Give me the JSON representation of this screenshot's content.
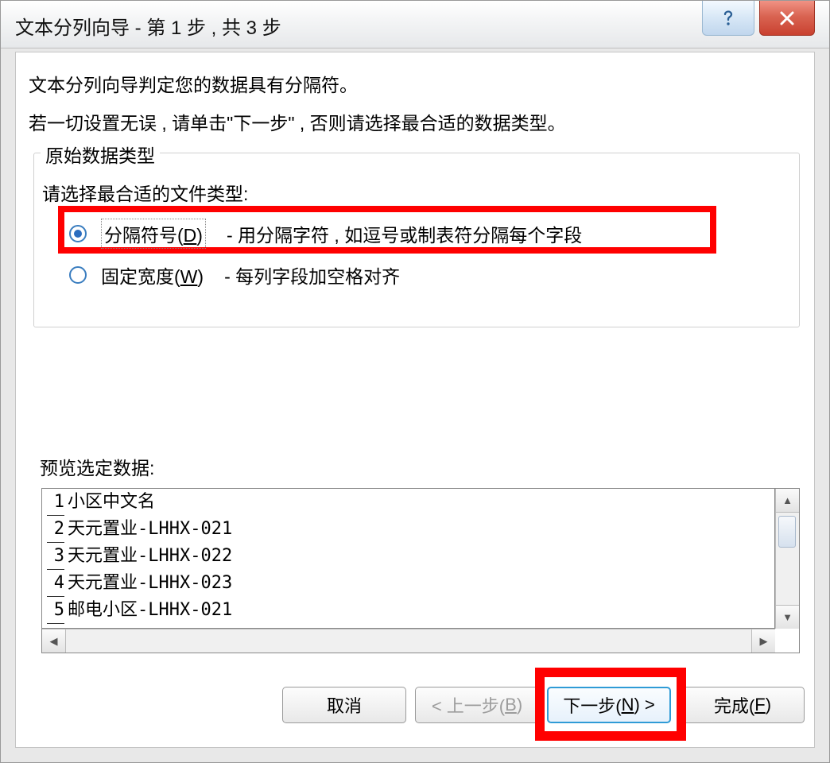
{
  "titlebar": {
    "title": "文本分列向导 - 第 1 步 , 共 3 步"
  },
  "intro": {
    "line1": "文本分列向导判定您的数据具有分隔符。",
    "line2": "若一切设置无误 , 请单击\"下一步\" , 否则请选择最合适的数据类型。"
  },
  "fieldset": {
    "legend": "原始数据类型",
    "choose_label": "请选择最合适的文件类型:"
  },
  "radios": {
    "delimited": {
      "label_prefix": "分隔符号(",
      "label_key": "D",
      "label_suffix": ")",
      "desc": "- 用分隔字符 , 如逗号或制表符分隔每个字段",
      "checked": true
    },
    "fixed": {
      "label_prefix": "固定宽度(",
      "label_key": "W",
      "label_suffix": ")",
      "desc": "- 每列字段加空格对齐",
      "checked": false
    }
  },
  "preview": {
    "label": "预览选定数据:",
    "lines": [
      {
        "num": "1",
        "text": "小区中文名"
      },
      {
        "num": "2",
        "text": "天元置业-LHHX-021"
      },
      {
        "num": "3",
        "text": "天元置业-LHHX-022"
      },
      {
        "num": "4",
        "text": "天元置业-LHHX-023"
      },
      {
        "num": "5",
        "text": "邮电小区-LHHX-021"
      }
    ]
  },
  "buttons": {
    "cancel": "取消",
    "back_prefix": "< 上一步(",
    "back_key": "B",
    "back_suffix": ")",
    "next_prefix": "下一步(",
    "next_key": "N",
    "next_suffix": ") >",
    "finish_prefix": "完成(",
    "finish_key": "F",
    "finish_suffix": ")"
  }
}
